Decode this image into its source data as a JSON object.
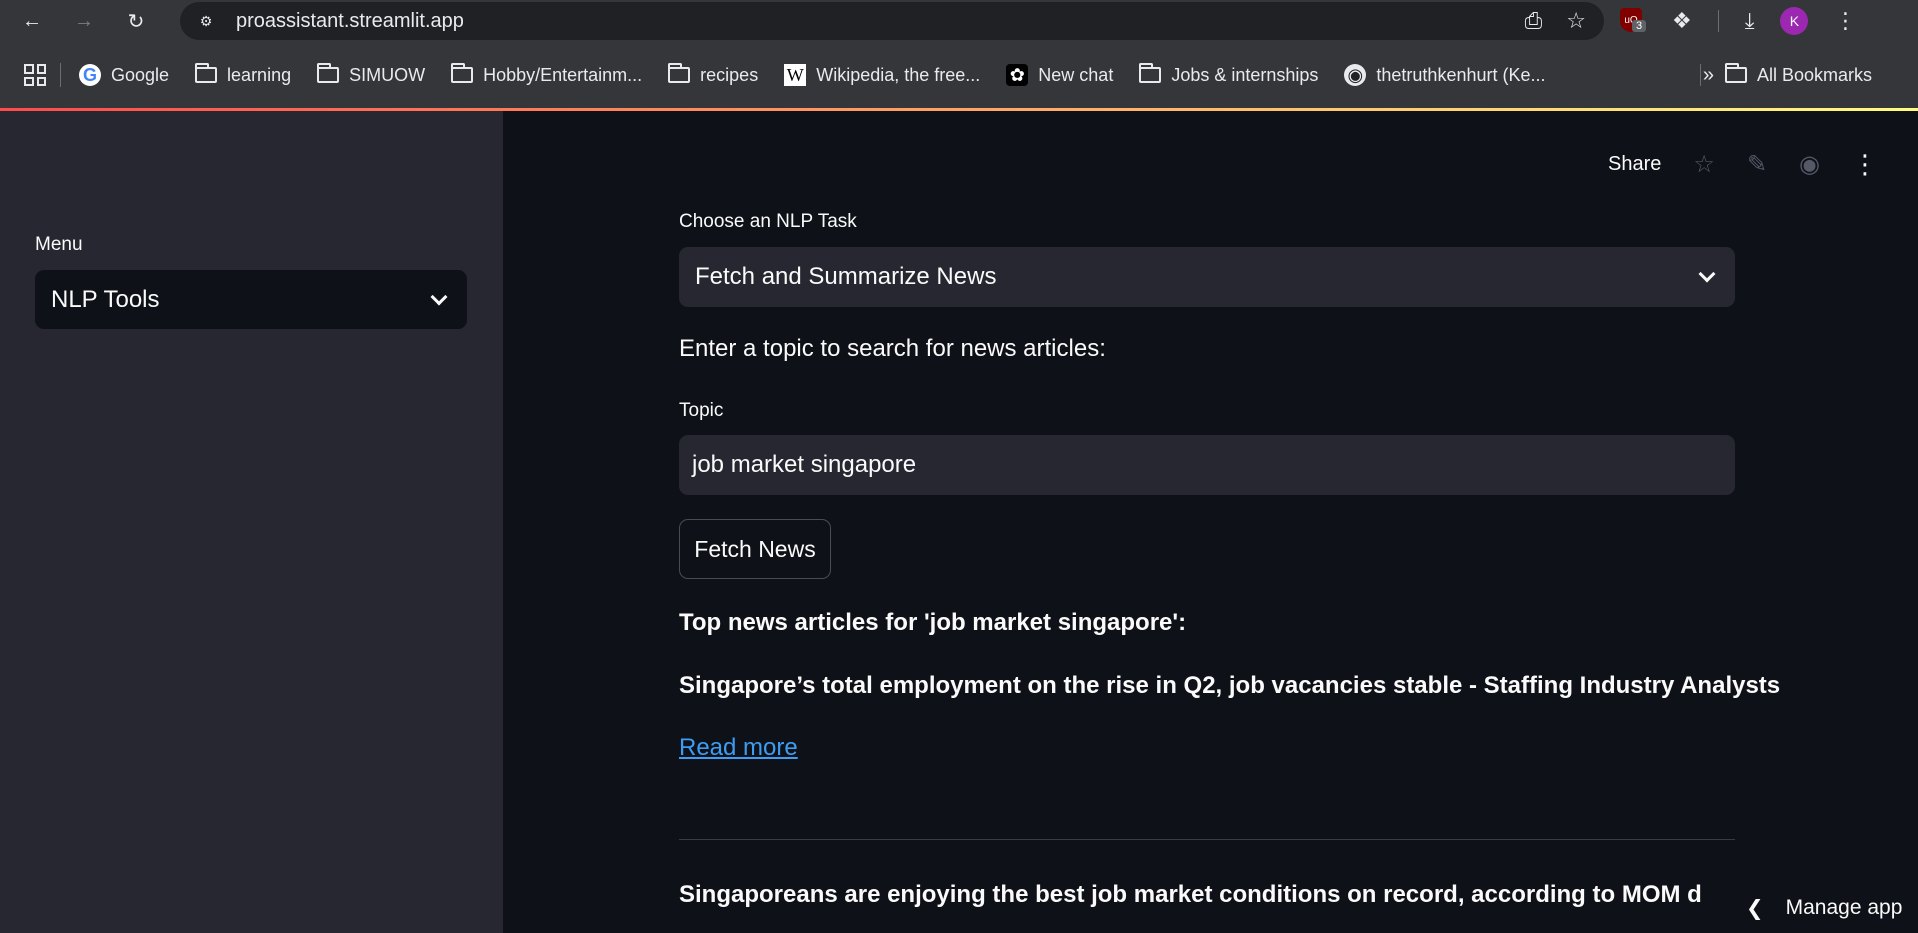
{
  "browser": {
    "url": "proassistant.streamlit.app",
    "ublock_count": "3",
    "profile_initial": "K",
    "bookmarks": [
      {
        "label": "Google",
        "icon": "google-icon"
      },
      {
        "label": "learning",
        "icon": "folder-icon"
      },
      {
        "label": "SIMUOW",
        "icon": "folder-icon"
      },
      {
        "label": "Hobby/Entertainm...",
        "icon": "folder-icon"
      },
      {
        "label": "recipes",
        "icon": "folder-icon"
      },
      {
        "label": "Wikipedia, the free...",
        "icon": "wikipedia-icon"
      },
      {
        "label": "New chat",
        "icon": "chatgpt-icon"
      },
      {
        "label": "Jobs & internships",
        "icon": "folder-icon"
      },
      {
        "label": "thetruthkenhurt (Ke...",
        "icon": "github-icon"
      }
    ],
    "all_bookmarks": "All Bookmarks",
    "accent_gradient": [
      "#ff4b4b",
      "#fffd80"
    ]
  },
  "sidebar": {
    "menu_label": "Menu",
    "menu_value": "NLP Tools"
  },
  "header": {
    "share_label": "Share"
  },
  "main": {
    "task_label": "Choose an NLP Task",
    "task_value": "Fetch and Summarize News",
    "prompt_text": "Enter a topic to search for news articles:",
    "topic_label": "Topic",
    "topic_value": "job market singapore",
    "fetch_button": "Fetch News",
    "results_heading": "Top news articles for 'job market singapore':",
    "articles": [
      {
        "title": "Singapore’s total employment on the rise in Q2, job vacancies stable - Staffing Industry Analysts",
        "link": "Read more"
      },
      {
        "title": "Singaporeans are enjoying the best job market conditions on record, according to MOM data - Vulcan Post"
      }
    ]
  },
  "manage_app": "Manage app",
  "colors": {
    "link": "#3d9df3",
    "sidebar_bg": "#262730",
    "main_bg": "#0e1117"
  }
}
